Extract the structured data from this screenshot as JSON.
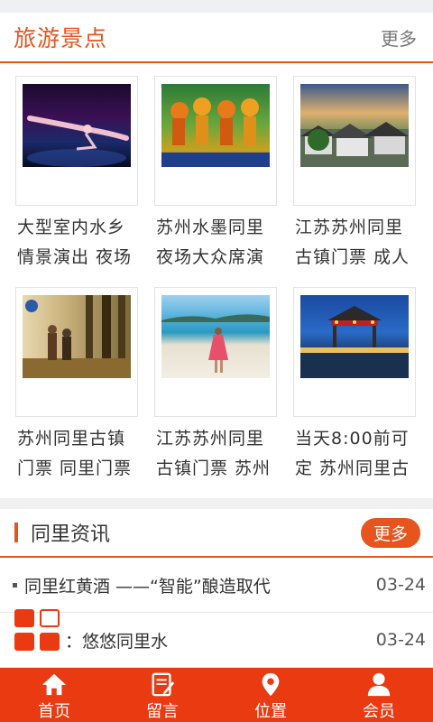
{
  "section": {
    "title": "旅游景点",
    "more": "更多"
  },
  "cards": [
    {
      "line1": "大型室内水乡",
      "line2": "情景演出 夜场"
    },
    {
      "line1": "苏州水墨同里",
      "line2": "夜场大众席演"
    },
    {
      "line1": "江苏苏州同里",
      "line2": "古镇门票 成人"
    },
    {
      "line1": "苏州同里古镇",
      "line2": "门票 同里门票"
    },
    {
      "line1": "江苏苏州同里",
      "line2": "古镇门票 苏州"
    },
    {
      "line1": "当天8:00前可",
      "line2": "定 苏州同里古"
    }
  ],
  "news": {
    "title": "同里资讯",
    "more": "更多",
    "items": [
      {
        "text": "同里红黄酒 ——“智能”酿造取代",
        "date": "03-24"
      },
      {
        "text": "：悠悠同里水",
        "date": "03-24"
      }
    ]
  },
  "tabs": [
    {
      "label": "首页",
      "icon": "home-icon"
    },
    {
      "label": "留言",
      "icon": "message-icon"
    },
    {
      "label": "位置",
      "icon": "location-icon"
    },
    {
      "label": "会员",
      "icon": "user-icon"
    }
  ],
  "colors": {
    "accent": "#e8541e",
    "tabbar": "#ea3a12"
  }
}
